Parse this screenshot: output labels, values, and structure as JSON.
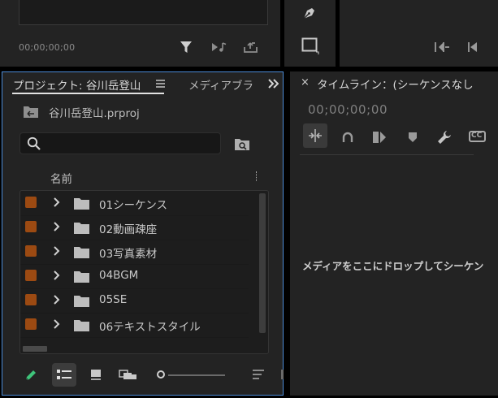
{
  "source_monitor": {
    "timecode": "00;00;00;00",
    "controls": [
      "filter-icon",
      "insert-audio-icon",
      "export-icon"
    ]
  },
  "tools": [
    "pen-icon",
    "rectangle-icon"
  ],
  "program_monitor": {
    "controls": [
      "go-to-in-icon",
      "step-back-icon"
    ]
  },
  "project_panel": {
    "active_tab": "プロジェクト: 谷川岳登山",
    "next_tab": "メディアブラ",
    "file_name": "谷川岳登山.prproj",
    "search": {
      "value": "",
      "placeholder": ""
    },
    "column_header": "名前",
    "items": [
      {
        "label": "01シーケンス",
        "color": "#9c4a12"
      },
      {
        "label": "02動画疎座",
        "color": "#9c4a12"
      },
      {
        "label": "03写真素材",
        "color": "#9c4a12"
      },
      {
        "label": "04BGM",
        "color": "#9c4a12"
      },
      {
        "label": "05SE",
        "color": "#9c4a12"
      },
      {
        "label": "06テキストスタイル",
        "color": "#9c4a12"
      }
    ]
  },
  "timeline_panel": {
    "close": "×",
    "title": "タイムライン：(シーケンスなし",
    "timecode": "00;00;00;00",
    "tools": [
      "snap-icon",
      "linked-selection-icon",
      "add-marker-icon",
      "marker-icon",
      "settings-wrench-icon",
      "captions-icon"
    ],
    "captions_label": "CC",
    "drop_hint": "メディアをここにドロップしてシーケン"
  },
  "colors": {
    "panel_bg": "#232323",
    "accent_blue": "#4c8bd6",
    "label_orange": "#9c4a12",
    "pen_green": "#3ec47a"
  }
}
